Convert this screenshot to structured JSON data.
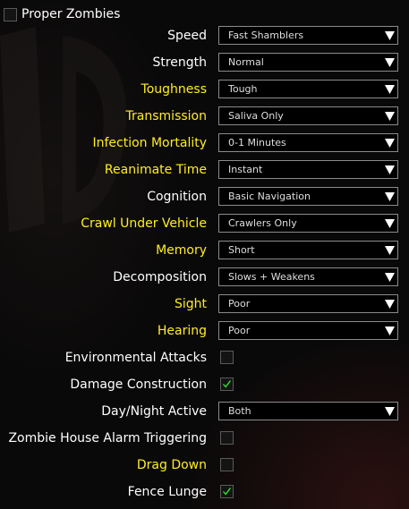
{
  "header": {
    "label": "Proper Zombies",
    "checked": false
  },
  "colors": {
    "highlight": "#ffee22",
    "normal": "#ffffff",
    "check": "#33ee33"
  },
  "rows": [
    {
      "label": "Speed",
      "type": "select",
      "value": "Fast Shamblers",
      "highlight": false
    },
    {
      "label": "Strength",
      "type": "select",
      "value": "Normal",
      "highlight": false
    },
    {
      "label": "Toughness",
      "type": "select",
      "value": "Tough",
      "highlight": true
    },
    {
      "label": "Transmission",
      "type": "select",
      "value": "Saliva Only",
      "highlight": true
    },
    {
      "label": "Infection Mortality",
      "type": "select",
      "value": "0-1 Minutes",
      "highlight": true
    },
    {
      "label": "Reanimate Time",
      "type": "select",
      "value": "Instant",
      "highlight": true
    },
    {
      "label": "Cognition",
      "type": "select",
      "value": "Basic Navigation",
      "highlight": false
    },
    {
      "label": "Crawl Under Vehicle",
      "type": "select",
      "value": "Crawlers Only",
      "highlight": true
    },
    {
      "label": "Memory",
      "type": "select",
      "value": "Short",
      "highlight": true
    },
    {
      "label": "Decomposition",
      "type": "select",
      "value": "Slows + Weakens",
      "highlight": false
    },
    {
      "label": "Sight",
      "type": "select",
      "value": "Poor",
      "highlight": true
    },
    {
      "label": "Hearing",
      "type": "select",
      "value": "Poor",
      "highlight": true
    },
    {
      "label": "Environmental Attacks",
      "type": "checkbox",
      "checked": false,
      "highlight": false
    },
    {
      "label": "Damage Construction",
      "type": "checkbox",
      "checked": true,
      "highlight": false
    },
    {
      "label": "Day/Night Active",
      "type": "select",
      "value": "Both",
      "highlight": false
    },
    {
      "label": "Zombie House Alarm Triggering",
      "type": "checkbox",
      "checked": false,
      "highlight": false
    },
    {
      "label": "Drag Down",
      "type": "checkbox",
      "checked": false,
      "highlight": true
    },
    {
      "label": "Fence Lunge",
      "type": "checkbox",
      "checked": true,
      "highlight": false
    }
  ]
}
